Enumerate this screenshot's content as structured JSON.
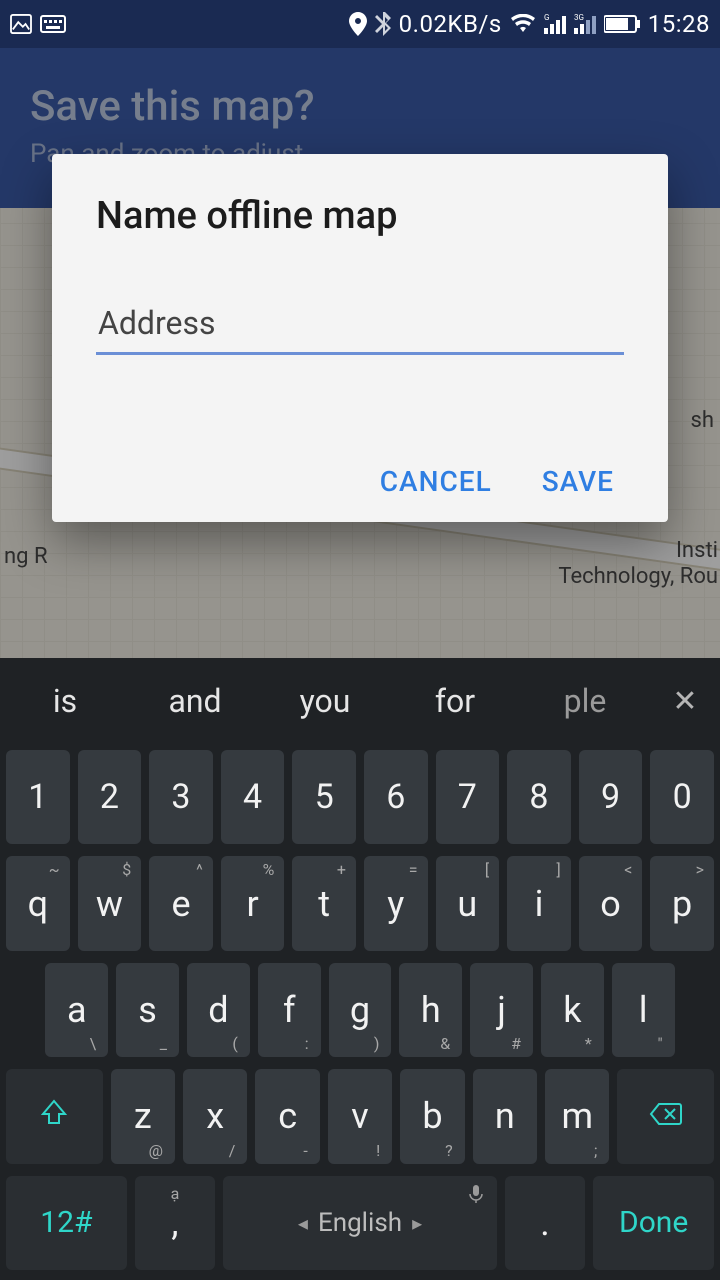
{
  "status": {
    "data_rate": "0.02KB/s",
    "time": "15:28"
  },
  "header": {
    "title": "Save this map?",
    "subtitle": "Pan and zoom to adjust"
  },
  "map": {
    "label_left": "ng R",
    "label_right_top": "sh",
    "label_right_1": "Insti",
    "label_right_2": "Technology, Rou"
  },
  "dialog": {
    "title": "Name offline map",
    "input_value": "Address",
    "cancel": "CANCEL",
    "save": "SAVE"
  },
  "keyboard": {
    "suggestions": [
      "is",
      "and",
      "you",
      "for",
      "ple"
    ],
    "row_num": [
      "1",
      "2",
      "3",
      "4",
      "5",
      "6",
      "7",
      "8",
      "9",
      "0"
    ],
    "row_q": [
      {
        "k": "q",
        "sup": "~"
      },
      {
        "k": "w",
        "sup": "$"
      },
      {
        "k": "e",
        "sup": "^"
      },
      {
        "k": "r",
        "sup": "%"
      },
      {
        "k": "t",
        "sup": "+"
      },
      {
        "k": "y",
        "sup": "="
      },
      {
        "k": "u",
        "sup": "["
      },
      {
        "k": "i",
        "sup": "]"
      },
      {
        "k": "o",
        "sup": "<"
      },
      {
        "k": "p",
        "sup": ">"
      }
    ],
    "row_a": [
      {
        "k": "a",
        "sub": "\\"
      },
      {
        "k": "s",
        "sub": "_"
      },
      {
        "k": "d",
        "sub": "("
      },
      {
        "k": "f",
        "sub": ":"
      },
      {
        "k": "g",
        "sub": ")"
      },
      {
        "k": "h",
        "sub": "&"
      },
      {
        "k": "j",
        "sub": "#"
      },
      {
        "k": "k",
        "sub": "*"
      },
      {
        "k": "l",
        "sub": "\""
      }
    ],
    "row_z": [
      {
        "k": "z",
        "sub": "@"
      },
      {
        "k": "x",
        "sub": "/"
      },
      {
        "k": "c",
        "sub": "-"
      },
      {
        "k": "v",
        "sub": "!"
      },
      {
        "k": "b",
        "sub": "?"
      },
      {
        "k": "n",
        "sub": ""
      },
      {
        "k": "m",
        "sub": ";"
      }
    ],
    "sym_key": "12#",
    "comma_key": ",",
    "comma_sup": "ạ",
    "space_label": "English",
    "period_key": ".",
    "done_key": "Done"
  }
}
